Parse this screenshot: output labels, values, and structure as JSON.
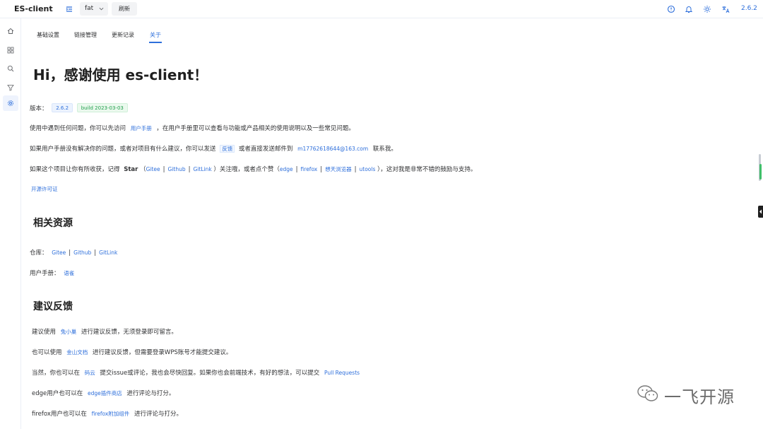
{
  "header": {
    "app_title": "ES-client",
    "env_select": "fat",
    "refresh_label": "刷新",
    "version": "2.6.2",
    "icons": [
      "info-icon",
      "bell-icon",
      "sun-icon",
      "translate-icon"
    ]
  },
  "sidebar": {
    "items": [
      {
        "icon": "home-icon"
      },
      {
        "icon": "grid-icon"
      },
      {
        "icon": "search-icon"
      },
      {
        "icon": "filter-icon"
      },
      {
        "icon": "gear-icon",
        "active": true
      }
    ]
  },
  "tabs": [
    {
      "label": "基础设置"
    },
    {
      "label": "链接管理"
    },
    {
      "label": "更新记录"
    },
    {
      "label": "关于",
      "active": true
    }
  ],
  "about": {
    "greeting": "Hi，感谢使用 es-client！",
    "version_label": "版本：",
    "version_badge": "2.6.2",
    "build_badge": "build 2023-03-03",
    "p1_a": "使用中遇到任何问题，你可以先访问",
    "p1_link": "用户手册",
    "p1_b": "，在用户手册里可以查看与功能或产品相关的使用说明以及一些常见问题。",
    "p2_a": "如果用户手册没有解决你的问题，或者对项目有什么建议，你可以发送",
    "p2_link": "反馈",
    "p2_b": "或者直接发送邮件到",
    "p2_email": "m17762618644@163.com",
    "p2_c": "联系我。",
    "p3_a": "如果这个项目让你有所收获，记得",
    "p3_star": "Star",
    "p3_paren_open": "（",
    "p3_links": [
      "Gitee",
      "Github",
      "GitLink"
    ],
    "p3_b": "）关注哦，或者点个赞（",
    "p3_like_links": [
      "edge",
      "firefox",
      "想天浏览器",
      "utools"
    ],
    "p3_c": "），这对我是非常不错的鼓励与支持。",
    "license_link": "开源许可证"
  },
  "resources": {
    "title": "相关资源",
    "repo_label": "仓库：",
    "repo_links": [
      "Gitee",
      "Github",
      "GitLink"
    ],
    "manual_label": "用户手册：",
    "manual_link": "语雀"
  },
  "feedback": {
    "title": "建议反馈",
    "l1_a": "建议使用",
    "l1_link": "兔小巢",
    "l1_b": "进行建议反馈，无须登录即可留言。",
    "l2_a": "也可以使用",
    "l2_link": "金山文档",
    "l2_b": "进行建议反馈，但需要登录WPS账号才能提交建议。",
    "l3_a": "当然，你也可以在",
    "l3_link": "码云",
    "l3_b": "提交issue或评论，我也会尽快回复。如果你也会前端技术，有好的想法，可以提交",
    "l3_link2": "Pull Requests",
    "l4_a": "edge用户也可以在",
    "l4_link": "edge插件商店",
    "l4_b": "进行评论与打分。",
    "l5_a": "firefox用户也可以在",
    "l5_link": "firefox附加组件",
    "l5_b": "进行评论与打分。"
  },
  "watermark": {
    "text": "一飞开源",
    "icon": "wechat-icon"
  },
  "colors": {
    "accent": "#2e6fdb",
    "success": "#1e9e4a",
    "scroll_accent": "#3fbf6a"
  }
}
